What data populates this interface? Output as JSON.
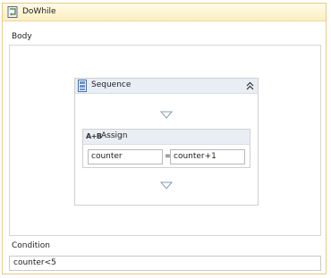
{
  "activity": {
    "title": "DoWhile",
    "body_label": "Body",
    "condition_label": "Condition",
    "condition_value": "counter<5"
  },
  "sequence": {
    "title": "Sequence"
  },
  "assign": {
    "title": "Assign",
    "icon_text": "A+B",
    "to_value": "counter",
    "operator": "=",
    "value_expression": "counter+1"
  }
}
